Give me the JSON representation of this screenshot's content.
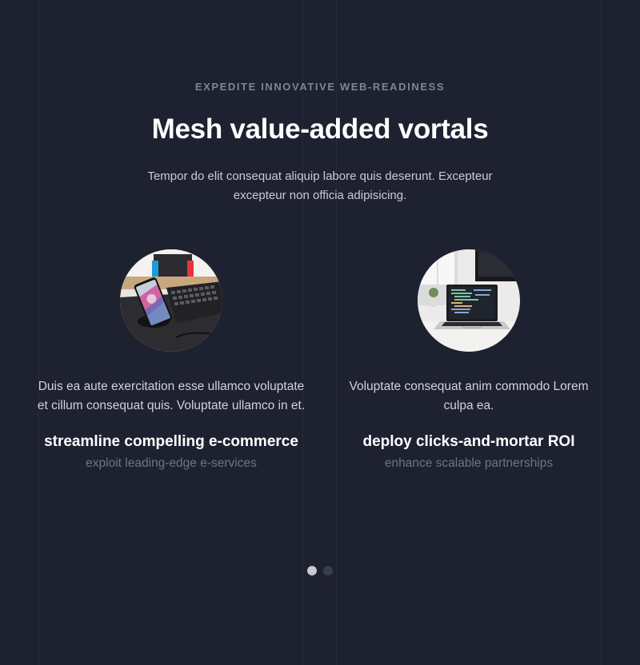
{
  "section": {
    "eyebrow": "EXPEDITE INNOVATIVE WEB-READINESS",
    "title": "Mesh value-added vortals",
    "intro": "Tempor do elit consequat aliquip labore quis deserunt. Excepteur excepteur non officia adipisicing."
  },
  "testimonials": [
    {
      "quote": "Duis ea aute exercitation esse ullamco voluptate et cillum consequat quis. Voluptate ullamco in et.",
      "name": "streamline compelling e-commerce",
      "role": "exploit leading-edge e-services",
      "image": "phone-on-desk-photo"
    },
    {
      "quote": "Voluptate consequat anim commodo Lorem culpa ea.",
      "name": "deploy clicks-and-mortar ROI",
      "role": "enhance scalable partnerships",
      "image": "laptop-on-desk-photo"
    }
  ],
  "pagination": {
    "count": 2,
    "active": 1
  },
  "colors": {
    "background": "#1e2130",
    "heading": "#ffffff",
    "muted": "#7f8596",
    "dot_active": "#c8cad0",
    "dot_inactive": "#3a3f4f"
  }
}
